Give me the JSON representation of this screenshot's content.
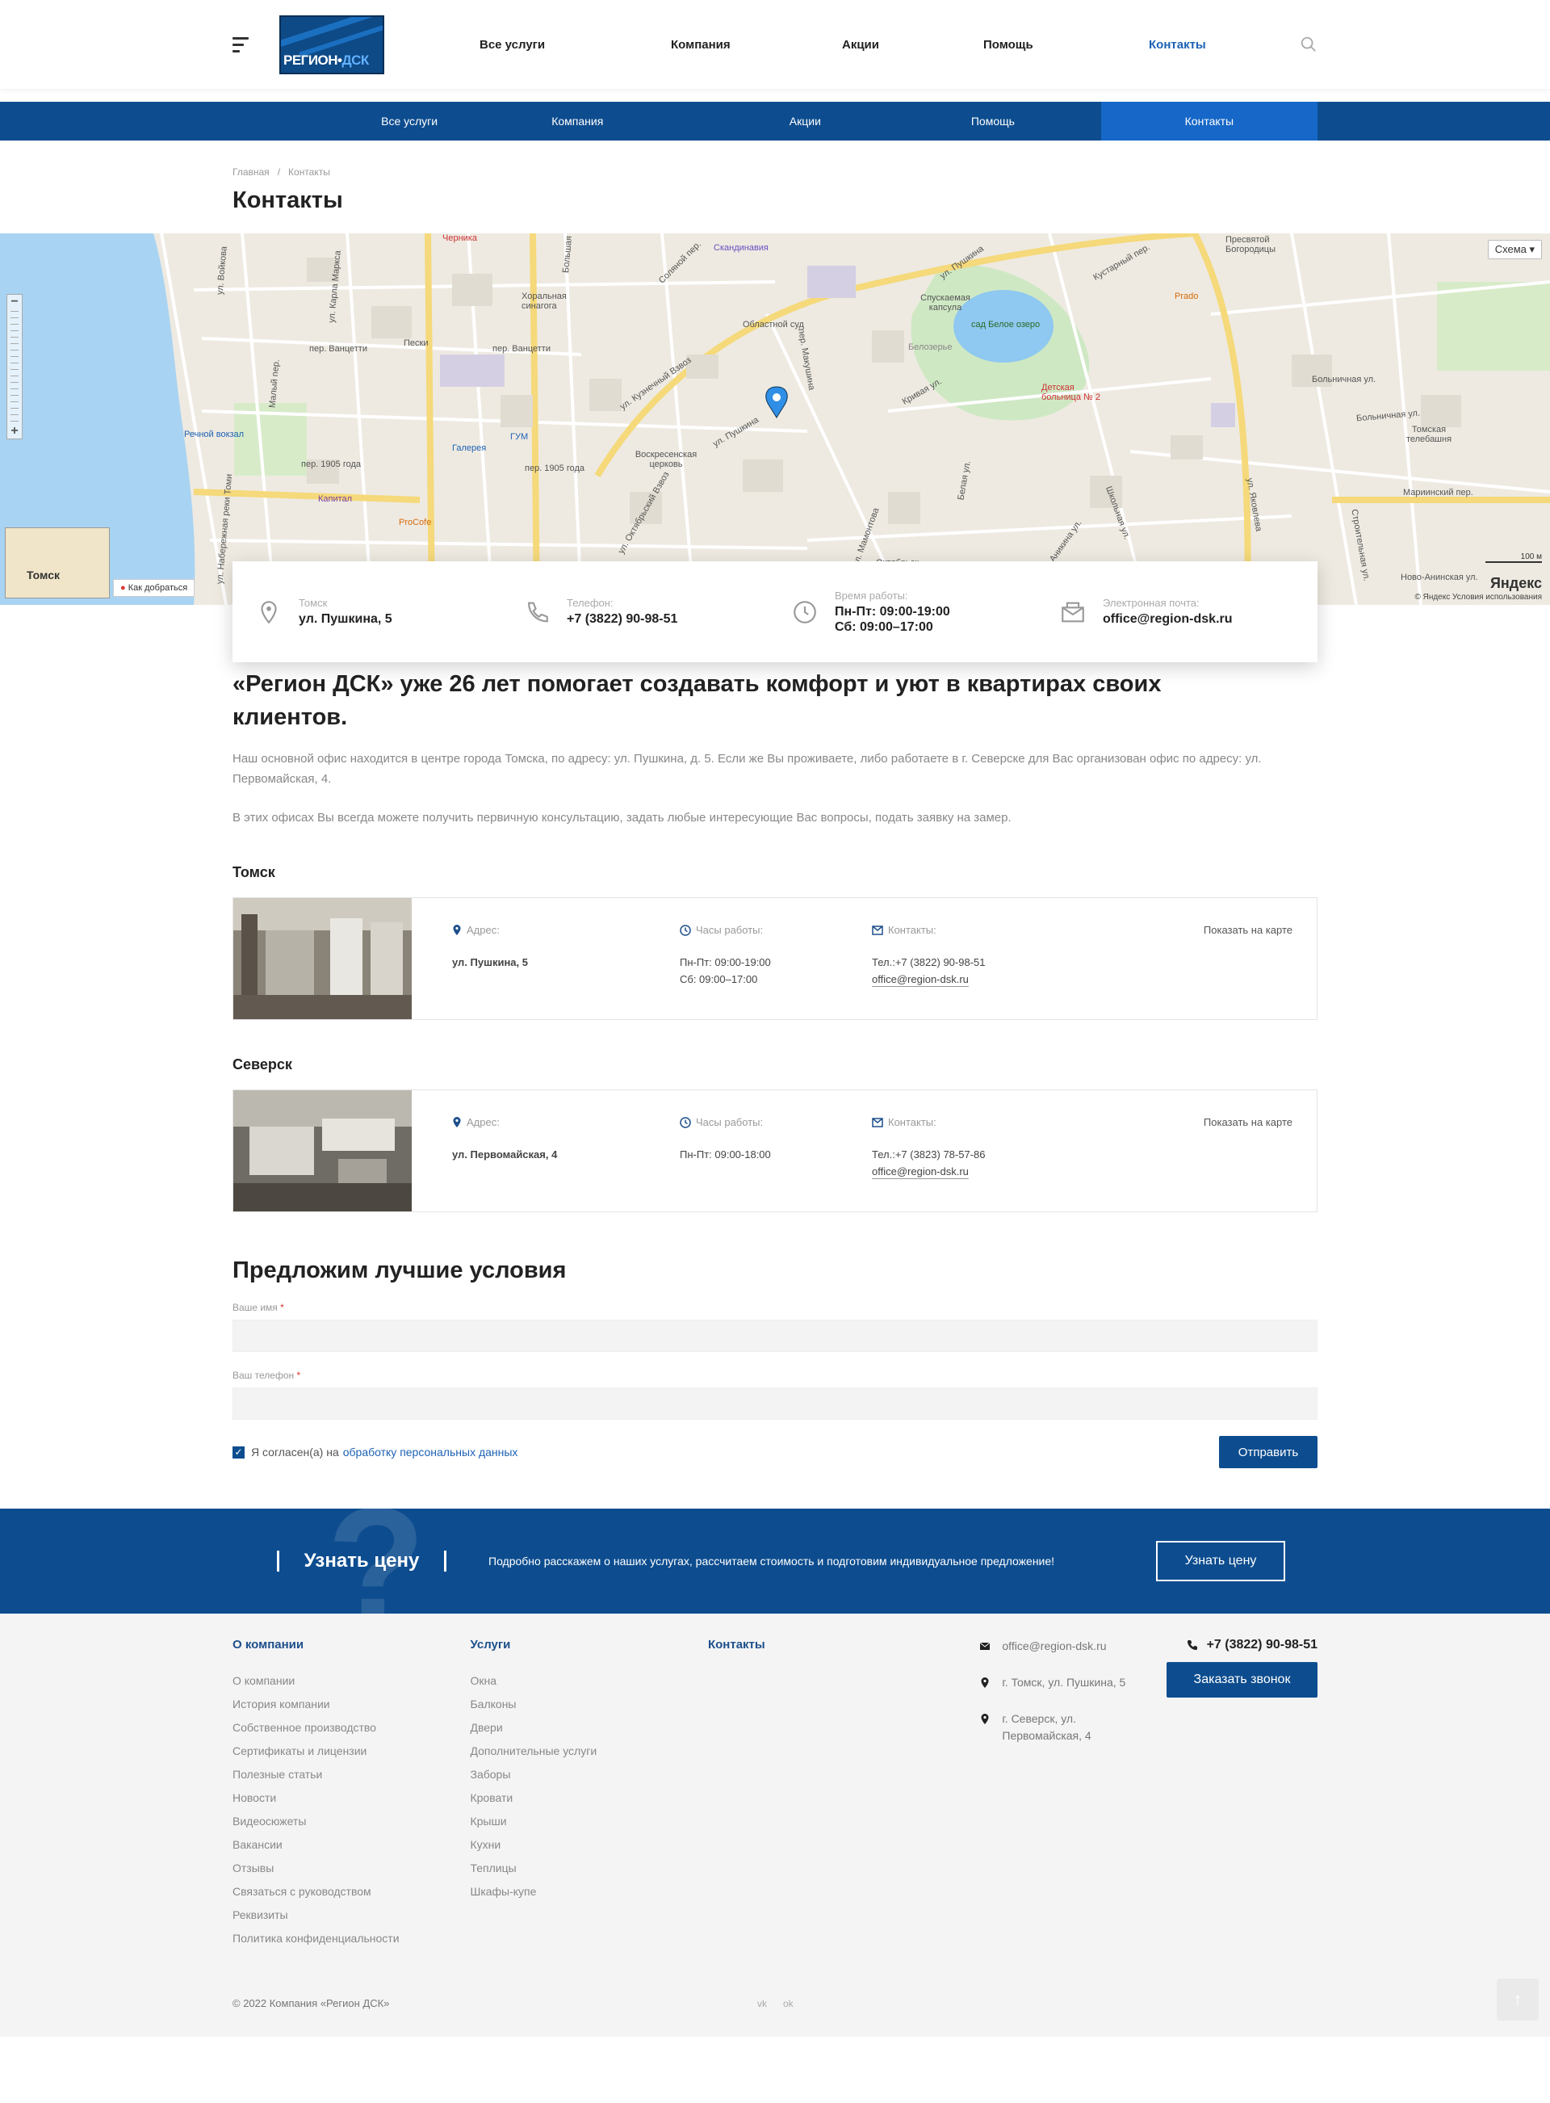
{
  "header": {
    "logo_text_a": "РЕГИОН",
    "logo_text_b": "ДСК",
    "nav": [
      "Все услуги",
      "Компания",
      "Акции",
      "Помощь",
      "Контакты"
    ],
    "active": "Контакты"
  },
  "bluenav": [
    "Все услуги",
    "Компания",
    "Акции",
    "Помощь",
    "Контакты"
  ],
  "breadcrumbs": {
    "home": "Главная",
    "current": "Контакты"
  },
  "page_title": "Контакты",
  "map": {
    "scheme": "Схема",
    "route": "Как добраться",
    "minimap_city": "Томск",
    "yandex": "Яндекс",
    "copyright": "© Яндекс  Условия использования",
    "scale": "100 м",
    "labels": {
      "chernika": "Черника",
      "skandinavia": "Скандинавия",
      "presvyatoy": "Пресвятой Богородицы",
      "horal": "Хоральная синагога",
      "oblsud": "Областной суд",
      "kapsula": "Спускаемая капсула",
      "sad": "сад Белое озеро",
      "prado": "Prado",
      "vokzal": "Речной вокзал",
      "peski": "Пески",
      "gum": "ГУМ",
      "galereya": "Галерея",
      "voskres": "Воскресенская церковь",
      "bolnica": "Детская больница № 2",
      "kapital": "Капитал",
      "procofe": "ProCofe",
      "telebash": "Томская телебашня",
      "marin": "Мариинский пер.",
      "novoan": "Ново-Анинская ул.",
      "pushkina": "ул. Пушкина",
      "kuzvz": "ул. Кузнечный Взвоз",
      "vanceti1": "пер. Ванцетти",
      "vanceti2": "пер. Ванцетти",
      "p1905": "пер. 1905 года",
      "p1905b": "пер. 1905 года",
      "krivaya": "Кривая ул.",
      "yakovleva": "ул. Яковлева",
      "bolnichnaya": "Больничная ул.",
      "oktyabrsky": "ул. Октябрьский Взвоз",
      "belozerye": "Белозерье",
      "shkolnaya": "Школьная ул.",
      "mamontova": "ул. Мамонтова",
      "oktyabr": "Октябрьск",
      "belaya": "Белая ул.",
      "anikina": "Аникина ул.",
      "karlamarksa": "ул. Карла Маркса",
      "bolshaya": "Большая",
      "solyanoy": "Соляной пер.",
      "pushkina2": "ул. Пушкина",
      "kustarnyi": "Кустарный пер.",
      "bolnichnaya2": "Больничная ул.",
      "vodnaya": "ул. Войкова",
      "makushina": "пер. Макушина",
      "malyi": "Малый пер.",
      "lavr": "ул. Набережная реки Томи",
      "stroit": "Строительная ул."
    }
  },
  "info": [
    {
      "key": "Томск",
      "value": "ул. Пушкина, 5",
      "icon": "location-icon"
    },
    {
      "key": "Телефон:",
      "value": "+7 (3822) 90-98-51",
      "icon": "phone-icon"
    },
    {
      "key": "Время работы:",
      "value": "Пн-Пт: 09:00-19:00",
      "value2": "Сб: 09:00–17:00",
      "icon": "clock-icon"
    },
    {
      "key": "Электронная почта:",
      "value": "office@region-dsk.ru",
      "icon": "mail-icon"
    }
  ],
  "intro": {
    "heading": "«Регион ДСК» уже 26 лет помогает создавать комфорт и уют в квартирах своих клиентов.",
    "p1": "Наш основной офис находится в центре города Томска, по адресу: ул. Пушкина, д. 5. Если же Вы проживаете, либо работаете в г. Северске для Вас организован офис по адресу: ул. Первомайская, 4.",
    "p2": "В этих офисах Вы всегда можете получить первичную консультацию, задать любые интересующие Вас вопросы, подать заявку на замер."
  },
  "offices": [
    {
      "city": "Томск",
      "addr_label": "Адрес:",
      "addr": "ул. Пушкина, 5",
      "hours_label": "Часы работы:",
      "hours1": "Пн-Пт: 09:00-19:00",
      "hours2": "Сб: 09:00–17:00",
      "contacts_label": "Контакты:",
      "phone": "Тел.:+7 (3822) 90-98-51",
      "email": "office@region-dsk.ru",
      "show": "Показать на карте"
    },
    {
      "city": "Северск",
      "addr_label": "Адрес:",
      "addr": "ул. Первомайская, 4",
      "hours_label": "Часы работы:",
      "hours1": "Пн-Пт: 09:00-18:00",
      "hours2": "",
      "contacts_label": "Контакты:",
      "phone": "Тел.:+7 (3823) 78-57-86",
      "email": "office@region-dsk.ru",
      "show": "Показать на карте"
    }
  ],
  "form": {
    "title": "Предложим лучшие условия",
    "name_label": "Ваше имя",
    "phone_label": "Ваш телефон",
    "required": "*",
    "agree": "Я согласен(а) на",
    "agree_link": "обработку персональных данных",
    "submit": "Отправить"
  },
  "cta": {
    "title": "Узнать цену",
    "desc": "Подробно расскажем о наших услугах, рассчитаем стоимость и подготовим индивидуальное предложение!",
    "button": "Узнать цену",
    "question": "?"
  },
  "footer": {
    "col1_title": "О компании",
    "col1": [
      "О компании",
      "История компании",
      "Собственное производство",
      "Сертификаты и лицензии",
      "Полезные статьи",
      "Новости",
      "Видеосюжеты",
      "Вакансии",
      "Отзывы",
      "Связаться с руководством",
      "Реквизиты",
      "Политика конфиденциальности"
    ],
    "col2_title": "Услуги",
    "col2": [
      "Окна",
      "Балконы",
      "Двери",
      "Дополнительные услуги",
      "Заборы",
      "Кровати",
      "Крыши",
      "Кухни",
      "Теплицы",
      "Шкафы-купе"
    ],
    "col3_title": "Контакты",
    "email": "office@region-dsk.ru",
    "addr1": "г. Томск, ул. Пушкина, 5",
    "addr2": "г. Северск, ул. Первомайская, 4",
    "phone": "+7 (3822) 90-98-51",
    "callback": "Заказать звонок",
    "copyright": "© 2022 Компания «Регион ДСК»",
    "social_vk": "vk",
    "social_ok": "ok"
  }
}
